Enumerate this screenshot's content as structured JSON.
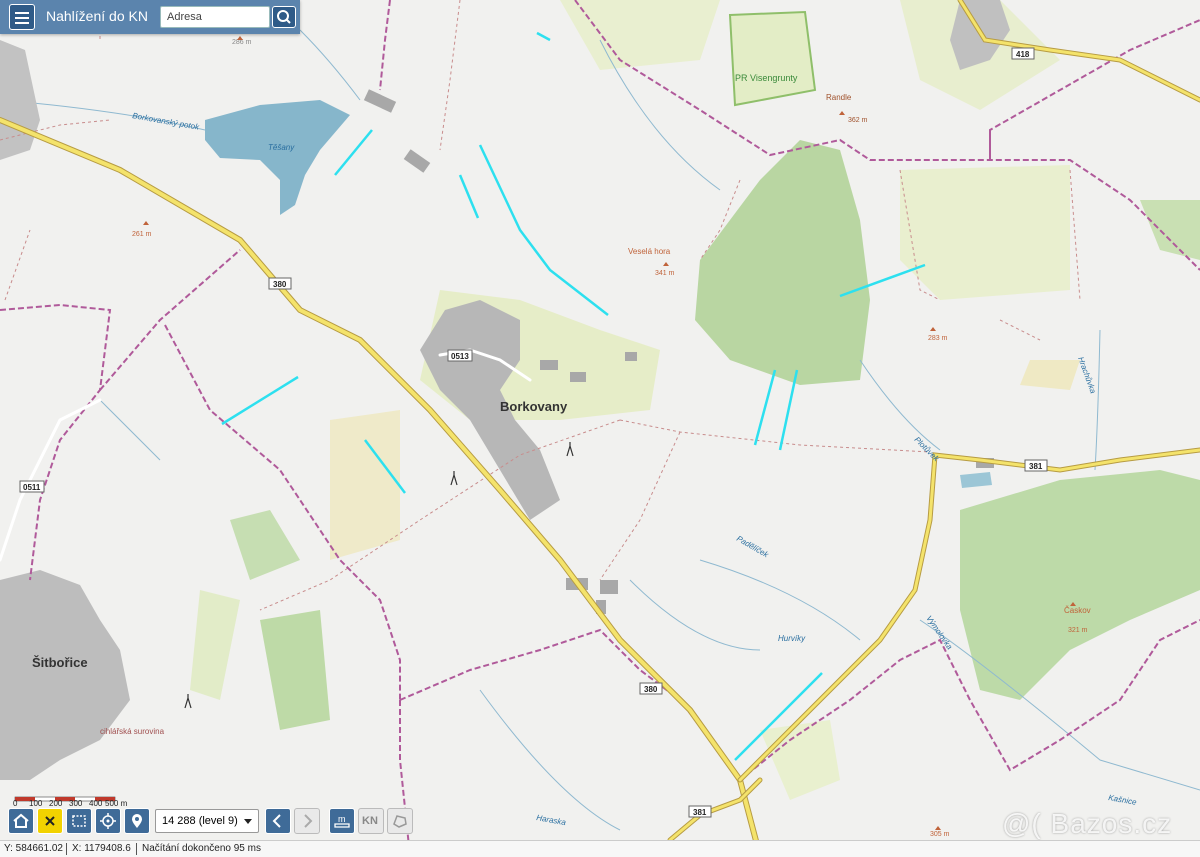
{
  "header": {
    "title": "Nahlížení do KN",
    "search_placeholder": "Adresa"
  },
  "map": {
    "places": {
      "borkovany": "Borkovany",
      "sitborice": "Šitbořice",
      "tesany": "Těšany",
      "pr_visengrunty": "PR Visengrunty",
      "randle": "Randle",
      "vesela_hora": "Veselá hora",
      "caskov": "Časkov",
      "cihlarska_surovina": "cihlářská surovina"
    },
    "elevations": [
      "286 m",
      "362 m",
      "261 m",
      "341 m",
      "283 m",
      "321 m",
      "305 m"
    ],
    "streams": [
      "Borkovanský potok",
      "Hrachůvka",
      "Plotůvek",
      "Padělíček",
      "Hurvíky",
      "Výmolovka",
      "Haraska",
      "Kašnice"
    ],
    "roads": [
      "418",
      "380",
      "0513",
      "381",
      "0511",
      "380",
      "381"
    ]
  },
  "scale": {
    "labels": [
      "0",
      "100",
      "200",
      "300",
      "400",
      "500 m"
    ]
  },
  "toolbar": {
    "zoom_value": "14 288 (level 9)",
    "kn_label": "KN"
  },
  "status": {
    "y": "Y: 584661.02",
    "x": "X: 1179408.6",
    "load": "Načítání dokončeno 95 ms"
  },
  "watermark": "@( Bazos.cz",
  "colors": {
    "header": "#5b84ad",
    "border_dash": "#b05a9a",
    "road": "#f4e36b",
    "water": "#86b6cb",
    "forest": "#b6d5a0",
    "cyan_line": "#2de0ef"
  }
}
